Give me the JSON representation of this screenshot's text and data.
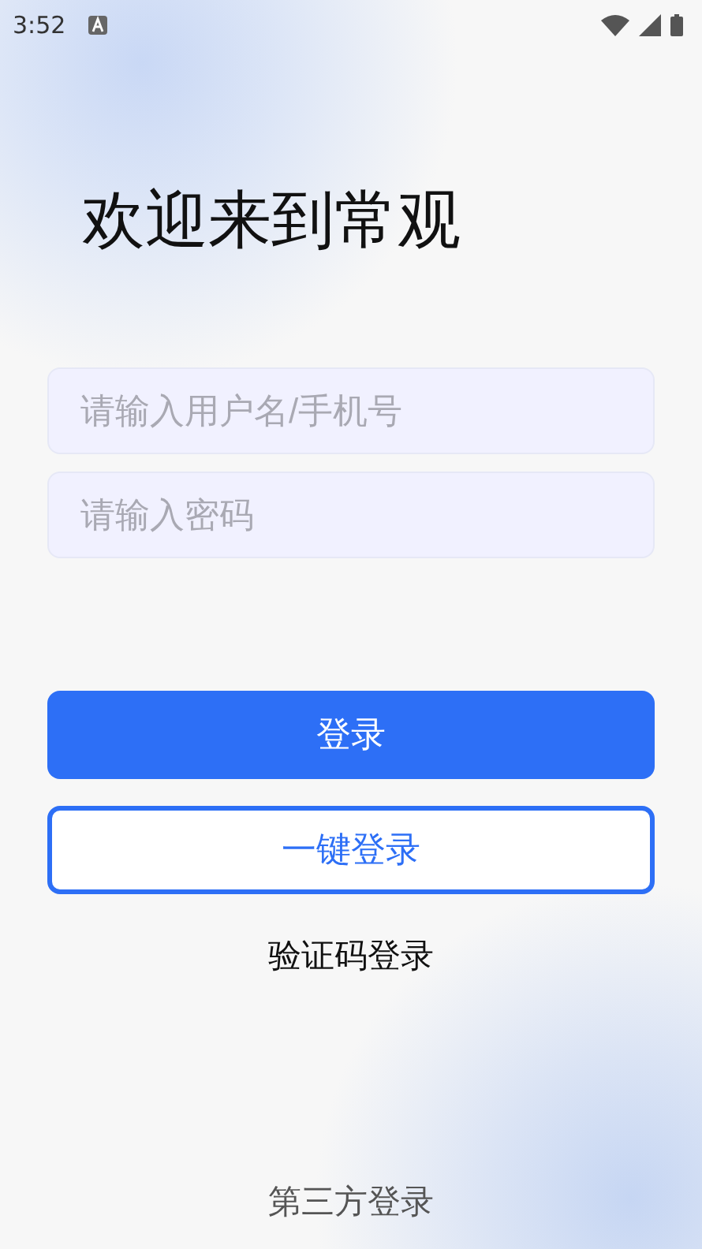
{
  "status_bar": {
    "time": "3:52"
  },
  "title": "欢迎来到常观",
  "fields": [
    {
      "placeholder": "请输入用户名/手机号"
    },
    {
      "placeholder": "请输入密码"
    }
  ],
  "buttons": [
    {
      "label": "登录",
      "kind": "primary"
    },
    {
      "label": "一键登录",
      "kind": "outline"
    }
  ],
  "links": [
    {
      "label": "验证码登录",
      "kind": "dark"
    }
  ],
  "footer": {
    "label": "第三方登录"
  }
}
